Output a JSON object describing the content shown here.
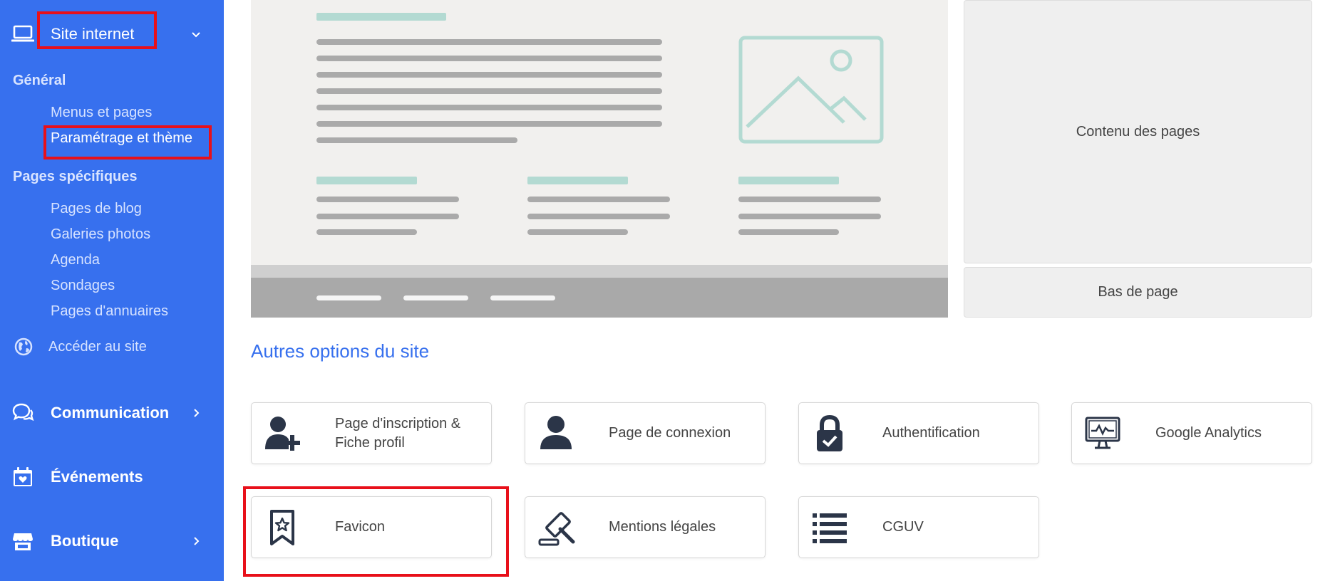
{
  "sidebar": {
    "site_internet": "Site internet",
    "general": "Général",
    "menus_pages": "Menus et pages",
    "parametrage": "Paramétrage et thème",
    "pages_specifiques": "Pages spécifiques",
    "sub_items": [
      "Pages de blog",
      "Galeries photos",
      "Agenda",
      "Sondages",
      "Pages d'annuaires"
    ],
    "acceder": "Accéder au site",
    "communication": "Communication",
    "evenements": "Événements",
    "boutique": "Boutique"
  },
  "main": {
    "contenu": "Contenu des pages",
    "bas": "Bas de page",
    "section_title": "Autres options du site",
    "cards": [
      {
        "label": "Page d'inscription & Fiche profil",
        "icon": "user-add-icon"
      },
      {
        "label": "Page de connexion",
        "icon": "user-icon"
      },
      {
        "label": "Authentification",
        "icon": "lock-check-icon"
      },
      {
        "label": "Google Analytics",
        "icon": "monitor-chart-icon"
      },
      {
        "label": "Favicon",
        "icon": "bookmark-star-icon"
      },
      {
        "label": "Mentions légales",
        "icon": "gavel-icon"
      },
      {
        "label": "CGUV",
        "icon": "list-icon"
      }
    ]
  },
  "colors": {
    "sidebar_bg": "#3770ee",
    "accent": "#3770ee",
    "highlight_box": "#e8101a",
    "icon_dark": "#2b3548",
    "placeholder_teal": "#b3dad2"
  }
}
